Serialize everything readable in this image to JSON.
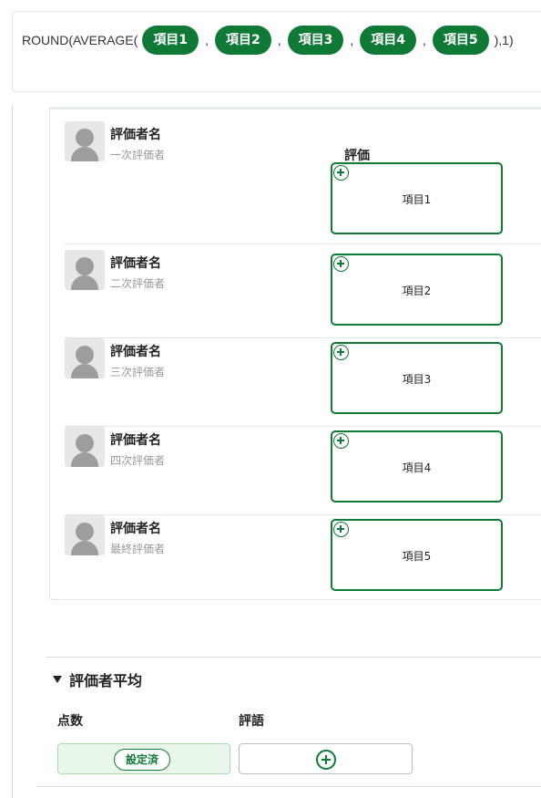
{
  "formula": {
    "prefix": "ROUND(AVERAGE(",
    "separator": ",",
    "suffix": "),1)",
    "tokens": [
      "項目1",
      "項目2",
      "項目3",
      "項目4",
      "項目5"
    ]
  },
  "evaluators": {
    "score_header": "評価",
    "rows": [
      {
        "name": "評価者名",
        "role": "一次評価者",
        "slot_label": "項目1"
      },
      {
        "name": "評価者名",
        "role": "二次評価者",
        "slot_label": "項目2"
      },
      {
        "name": "評価者名",
        "role": "三次評価者",
        "slot_label": "項目3"
      },
      {
        "name": "評価者名",
        "role": "四次評価者",
        "slot_label": "項目4"
      },
      {
        "name": "評価者名",
        "role": "最終評価者",
        "slot_label": "項目5"
      }
    ]
  },
  "average": {
    "title": "評価者平均",
    "score_label": "点数",
    "comment_label": "評語",
    "set_badge": "設定済"
  },
  "colors": {
    "accent": "#0e7a36",
    "set_bg": "#e9f7ea"
  },
  "icons": {
    "avatar": "person-avatar-icon",
    "add": "plus-circle-icon",
    "collapse": "triangle-down-icon"
  }
}
